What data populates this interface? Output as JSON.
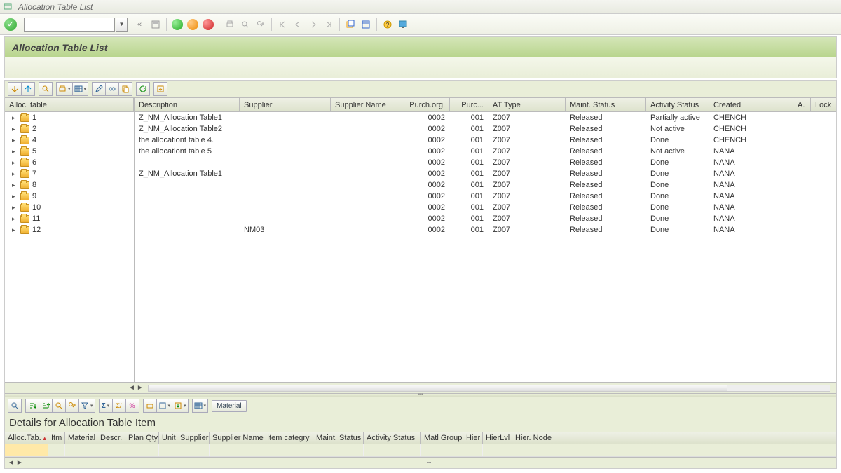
{
  "menubar": {
    "title": "Allocation Table List"
  },
  "header": {
    "title": "Allocation Table List"
  },
  "tree": {
    "header": "Alloc. table",
    "columns": {
      "desc": "Description",
      "supp": "Supplier",
      "sname": "Supplier Name",
      "porg": "Purch.org.",
      "pgrp": "Purc...",
      "attype": "AT Type",
      "maint": "Maint. Status",
      "act": "Activity Status",
      "created": "Created",
      "a": "A.",
      "lock": "Lock"
    },
    "rows": [
      {
        "id": "1",
        "desc": "Z_NM_Allocation Table1",
        "supp": "",
        "porg": "0002",
        "pgrp": "001",
        "attype": "Z007",
        "maint": "Released",
        "act": "Partially active",
        "created": "CHENCH"
      },
      {
        "id": "2",
        "desc": "Z_NM_Allocation Table2",
        "supp": "",
        "porg": "0002",
        "pgrp": "001",
        "attype": "Z007",
        "maint": "Released",
        "act": "Not active",
        "created": "CHENCH"
      },
      {
        "id": "4",
        "desc": "the allocationt table 4.",
        "supp": "",
        "porg": "0002",
        "pgrp": "001",
        "attype": "Z007",
        "maint": "Released",
        "act": "Done",
        "created": "CHENCH"
      },
      {
        "id": "5",
        "desc": "the allocationt table 5",
        "supp": "",
        "porg": "0002",
        "pgrp": "001",
        "attype": "Z007",
        "maint": "Released",
        "act": "Not active",
        "created": "NANA"
      },
      {
        "id": "6",
        "desc": "",
        "supp": "",
        "porg": "0002",
        "pgrp": "001",
        "attype": "Z007",
        "maint": "Released",
        "act": "Done",
        "created": "NANA"
      },
      {
        "id": "7",
        "desc": "Z_NM_Allocation Table1",
        "supp": "",
        "porg": "0002",
        "pgrp": "001",
        "attype": "Z007",
        "maint": "Released",
        "act": "Done",
        "created": "NANA"
      },
      {
        "id": "8",
        "desc": "",
        "supp": "",
        "porg": "0002",
        "pgrp": "001",
        "attype": "Z007",
        "maint": "Released",
        "act": "Done",
        "created": "NANA"
      },
      {
        "id": "9",
        "desc": "",
        "supp": "",
        "porg": "0002",
        "pgrp": "001",
        "attype": "Z007",
        "maint": "Released",
        "act": "Done",
        "created": "NANA"
      },
      {
        "id": "10",
        "desc": "",
        "supp": "",
        "porg": "0002",
        "pgrp": "001",
        "attype": "Z007",
        "maint": "Released",
        "act": "Done",
        "created": "NANA"
      },
      {
        "id": "11",
        "desc": "",
        "supp": "",
        "porg": "0002",
        "pgrp": "001",
        "attype": "Z007",
        "maint": "Released",
        "act": "Done",
        "created": "NANA"
      },
      {
        "id": "12",
        "desc": "",
        "supp": "NM03",
        "porg": "0002",
        "pgrp": "001",
        "attype": "Z007",
        "maint": "Released",
        "act": "Done",
        "created": "NANA"
      }
    ]
  },
  "details": {
    "title": "Details for Allocation Table Item",
    "material_btn": "Material",
    "columns": [
      "Alloc.Tab.",
      "Itm",
      "Material",
      "Descr.",
      "Plan Qty",
      "Unit",
      "Supplier",
      "Supplier Name",
      "Item categry",
      "Maint. Status",
      "Activity Status",
      "Matl Group",
      "Hier",
      "HierLvl",
      "Hier. Node"
    ]
  }
}
